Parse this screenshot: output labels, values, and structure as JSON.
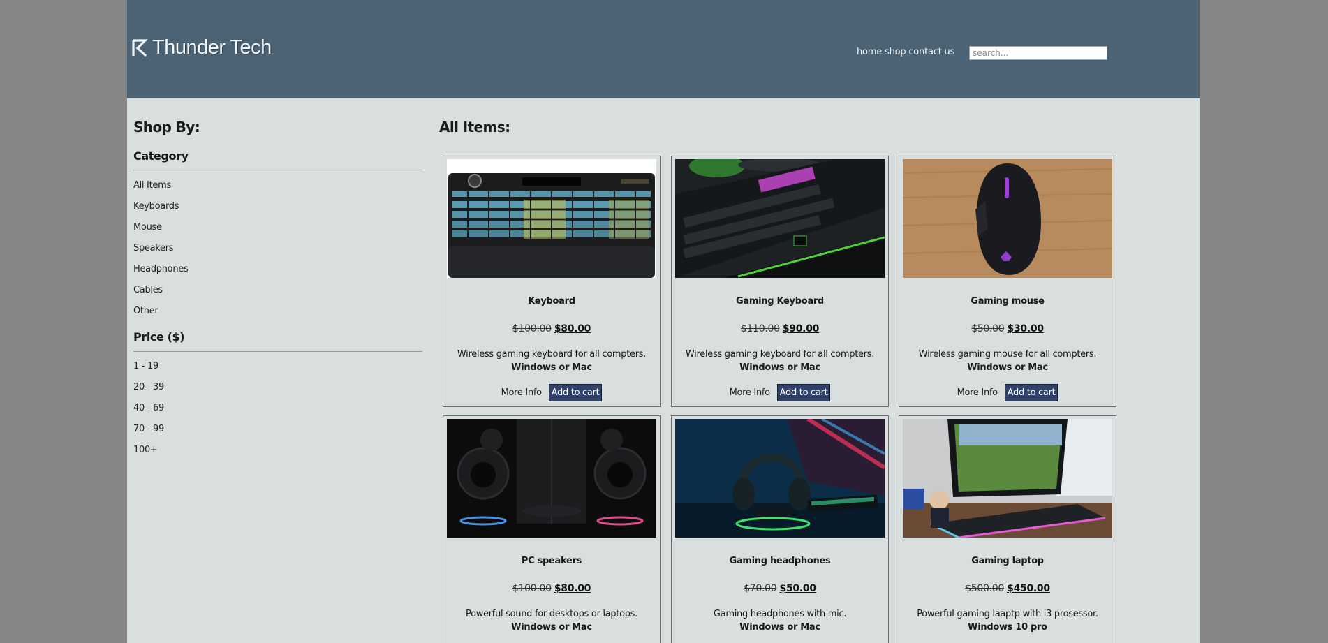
{
  "header": {
    "logo_text": "Thunder Tech",
    "nav": [
      "home",
      "shop",
      "contact us"
    ],
    "search_placeholder": "search..."
  },
  "sidebar": {
    "title": "Shop By:",
    "category_title": "Category",
    "categories": [
      "All Items",
      "Keyboards",
      "Mouse",
      "Speakers",
      "Headphones",
      "Cables",
      "Other"
    ],
    "price_title": "Price ($)",
    "price_ranges": [
      "1 - 19",
      "20 - 39",
      "40 - 69",
      "70 - 99",
      "100+"
    ]
  },
  "main": {
    "title": "All Items:",
    "more_info_label": "More Info",
    "add_to_cart_label": "Add to cart",
    "products": [
      {
        "name": "Keyboard",
        "old_price": "$100.00",
        "price": "$80.00",
        "description": "Wireless gaming keyboard for all compters.",
        "os": "Windows or Mac",
        "image": "keyboard-photo"
      },
      {
        "name": "Gaming Keyboard",
        "old_price": "$110.00",
        "price": "$90.00",
        "description": "Wireless gaming keyboard for all compters.",
        "os": "Windows or Mac",
        "image": "gaming-keyboard-photo"
      },
      {
        "name": "Gaming mouse",
        "old_price": "$50.00",
        "price": "$30.00",
        "description": "Wireless gaming mouse for all compters.",
        "os": "Windows or Mac",
        "image": "gaming-mouse-photo"
      },
      {
        "name": "PC speakers",
        "old_price": "$100.00",
        "price": "$80.00",
        "description": "Powerful sound for desktops or laptops.",
        "os": "Windows or Mac",
        "image": "pc-speakers-photo"
      },
      {
        "name": "Gaming headphones",
        "old_price": "$70.00",
        "price": "$50.00",
        "description": "Gaming headphones with mic.",
        "os": "Windows or Mac",
        "image": "gaming-headphones-photo"
      },
      {
        "name": "Gaming laptop",
        "old_price": "$500.00",
        "price": "$450.00",
        "description": "Powerful gaming laaptp with i3 prosessor.",
        "os": "Windows 10 pro",
        "image": "gaming-laptop-photo"
      }
    ]
  },
  "colors": {
    "page_background": "#868686",
    "header_background": "#4b6375",
    "content_background": "#d9dedf",
    "button_background": "#2f4168"
  }
}
